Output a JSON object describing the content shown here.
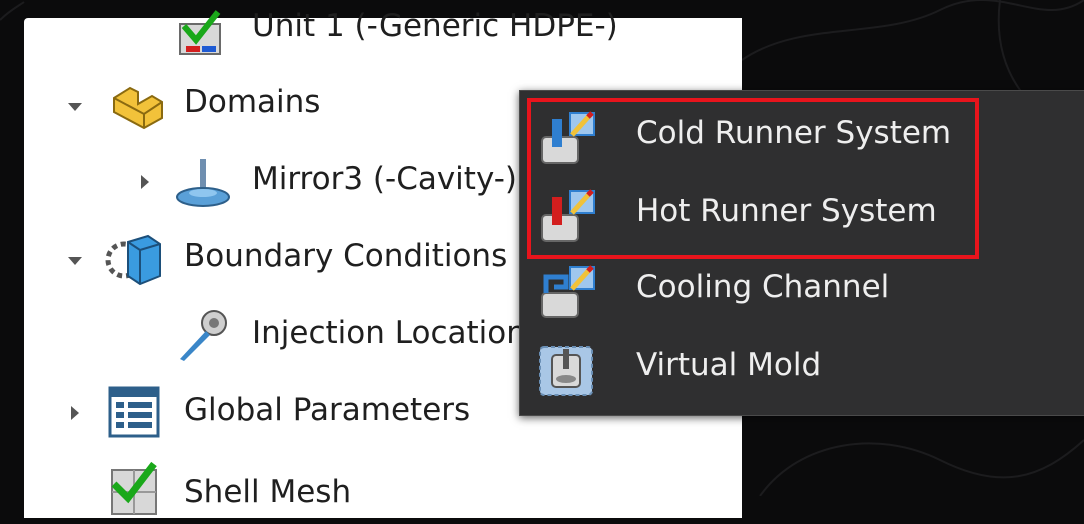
{
  "tree": {
    "items": [
      {
        "label": "Unit 1 (-Generic HDPE-)",
        "icon": "material-check-icon",
        "expander": "none"
      },
      {
        "label": "Domains",
        "icon": "domains-folder-icon",
        "expander": "expanded"
      },
      {
        "label": "Mirror3 (-Cavity-)",
        "icon": "cavity-part-icon",
        "expander": "collapsed"
      },
      {
        "label": "Boundary Conditions",
        "icon": "boundary-conditions-icon",
        "expander": "expanded"
      },
      {
        "label": "Injection Locations",
        "icon": "injection-location-icon",
        "expander": "none"
      },
      {
        "label": "Global Parameters",
        "icon": "global-parameters-icon",
        "expander": "collapsed"
      },
      {
        "label": "Shell Mesh",
        "icon": "mesh-check-icon",
        "expander": "none"
      }
    ]
  },
  "context_menu": {
    "items": [
      {
        "label": "Cold Runner System",
        "icon": "cold-runner-icon"
      },
      {
        "label": "Hot Runner System",
        "icon": "hot-runner-icon"
      },
      {
        "label": "Cooling Channel",
        "icon": "cooling-channel-icon"
      },
      {
        "label": "Virtual Mold",
        "icon": "virtual-mold-icon"
      }
    ],
    "highlight_color": "#e8141c"
  },
  "colors": {
    "background": "#0b0b0c",
    "menu_background": "#2f2f30",
    "menu_text": "#eeeeee",
    "tree_background": "#ffffff",
    "tree_text": "#1f1f1f"
  }
}
